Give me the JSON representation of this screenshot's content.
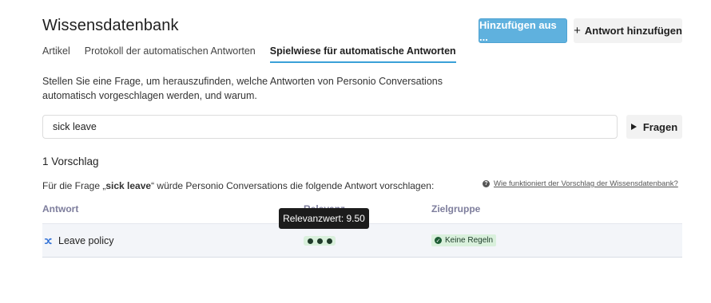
{
  "header": {
    "title": "Wissensdatenbank",
    "add_from_label": "Hinzufügen aus ...",
    "add_answer_plus": "+",
    "add_answer_label": "Antwort hinzufügen"
  },
  "tabs": [
    {
      "label": "Artikel"
    },
    {
      "label": "Protokoll der automatischen Antworten"
    },
    {
      "label": "Spielwiese für automatische Antworten"
    }
  ],
  "intro": "Stellen Sie eine Frage, um herauszufinden, welche Antworten von Personio Conversations automatisch vorgeschlagen werden, und warum.",
  "search": {
    "value": "sick leave",
    "ask_label": "Fragen"
  },
  "results": {
    "count_label": "1 Vorschlag",
    "desc_prefix": "Für die Frage „",
    "desc_query": "sick leave",
    "desc_suffix": "“ würde Personio Conversations die folgende Antwort vorschlagen:",
    "help_link": "Wie funktioniert der Vorschlag der Wissensdatenbank?",
    "columns": {
      "answer": "Antwort",
      "relevance": "Relevanz",
      "target": "Zielgruppe"
    },
    "rows": [
      {
        "answer": "Leave policy",
        "relevance_level": 3,
        "target_badge": "Keine Regeln"
      }
    ]
  },
  "tooltip": "Relevanzwert: 9.50",
  "colors": {
    "primary_button": "#5fb1de",
    "tab_active_underline": "#3aa0d8",
    "badge_bg": "#d9f0dc",
    "answer_icon": "#2f6fd6"
  },
  "icons": {
    "answer_row_icon": "shuffle-icon",
    "help_icon": "question-circle-icon",
    "ask_icon": "play-icon",
    "badge_icon": "check-circle-icon"
  }
}
